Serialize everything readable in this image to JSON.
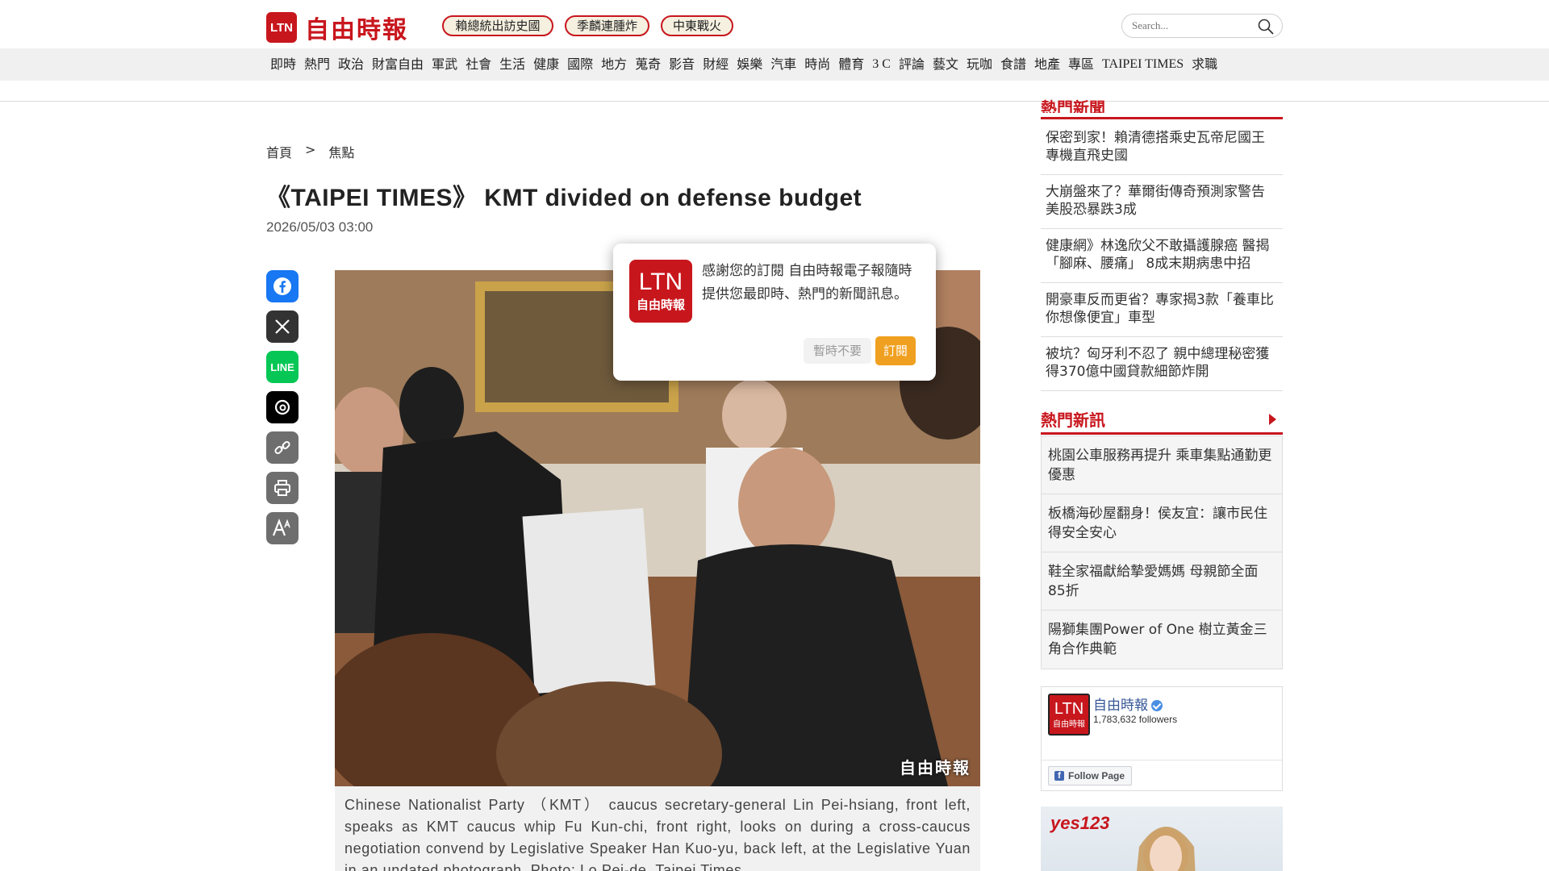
{
  "header": {
    "logo_mark": "LTN",
    "logo_text": "自由時報",
    "hot_tags": [
      "賴總統出訪史國",
      "季麟連腫炸",
      "中東戰火"
    ],
    "search_placeholder": "Search..."
  },
  "nav": {
    "items": [
      "即時",
      "熱門",
      "政治",
      "財富自由",
      "軍武",
      "社會",
      "生活",
      "健康",
      "國際",
      "地方",
      "蒐奇",
      "影音",
      "財經",
      "娛樂",
      "汽車",
      "時尚",
      "體育",
      "3 C",
      "評論",
      "藝文",
      "玩咖",
      "食譜",
      "地產",
      "專區",
      "TAIPEI TIMES",
      "求職"
    ]
  },
  "breadcrumb": {
    "home": "首頁",
    "separator": ">",
    "section": "焦點"
  },
  "article": {
    "title": "《TAIPEI TIMES》 KMT divided on defense budget",
    "date": "2026/05/03 03:00",
    "photo_watermark": "自由時報",
    "caption": "Chinese Nationalist Party （KMT） caucus secretary-general Lin Pei-hsiang, front left, speaks as KMT caucus whip Fu Kun-chi, front right, looks on during a cross-caucus negotiation convend by Legislative Speaker Han Kuo-yu, back left, at the Legislative Yuan in an undated photograph. Photo: Lo Pei-de, Taipei Times"
  },
  "share": {
    "icons": [
      "facebook-icon",
      "x-icon",
      "line-icon",
      "threads-icon",
      "link-icon",
      "print-icon",
      "font-size-icon"
    ],
    "line_label": "LINE"
  },
  "popup": {
    "logo_top": "LTN",
    "logo_bottom": "自由時報",
    "message": "感謝您的訂閱 自由時報電子報隨時提供您最即時、熱門的新聞訊息。",
    "decline_label": "暫時不要",
    "accept_label": "訂閱"
  },
  "sidebar": {
    "hot_news_title": "熱門新聞",
    "hot_news": [
      "保密到家！賴清德搭乘史瓦帝尼國王專機直飛史國",
      "大崩盤來了？華爾街傳奇預測家警告美股恐暴跌3成",
      "健康網》林逸欣父不敢攝護腺癌 醫揭「腳麻、腰痛」 8成末期病患中招",
      "開豪車反而更省？專家揭3款「養車比你想像便宜」車型",
      "被坑？匈牙利不忍了 親中總理秘密獲得370億中國貸款細節炸開"
    ],
    "new_news_title": "熱門新訊",
    "new_news": [
      "桃園公車服務再提升 乘車集點通勤更優惠",
      "板橋海砂屋翻身！侯友宜：讓市民住得安全安心",
      "鞋全家福獻給摯愛媽媽 母親節全面85折",
      "陽獅集團Power of One 樹立黃金三角合作典範"
    ],
    "facebook": {
      "logo_top": "LTN",
      "logo_bottom": "自由時報",
      "page_name": "自由時報",
      "followers": "1,783,632 followers",
      "follow_label": "Follow Page"
    },
    "ad_brand": "yes123"
  },
  "colors": {
    "brand_red": "#c8161d",
    "accept_orange": "#f0a020",
    "nav_bg": "#f0f0f0"
  }
}
